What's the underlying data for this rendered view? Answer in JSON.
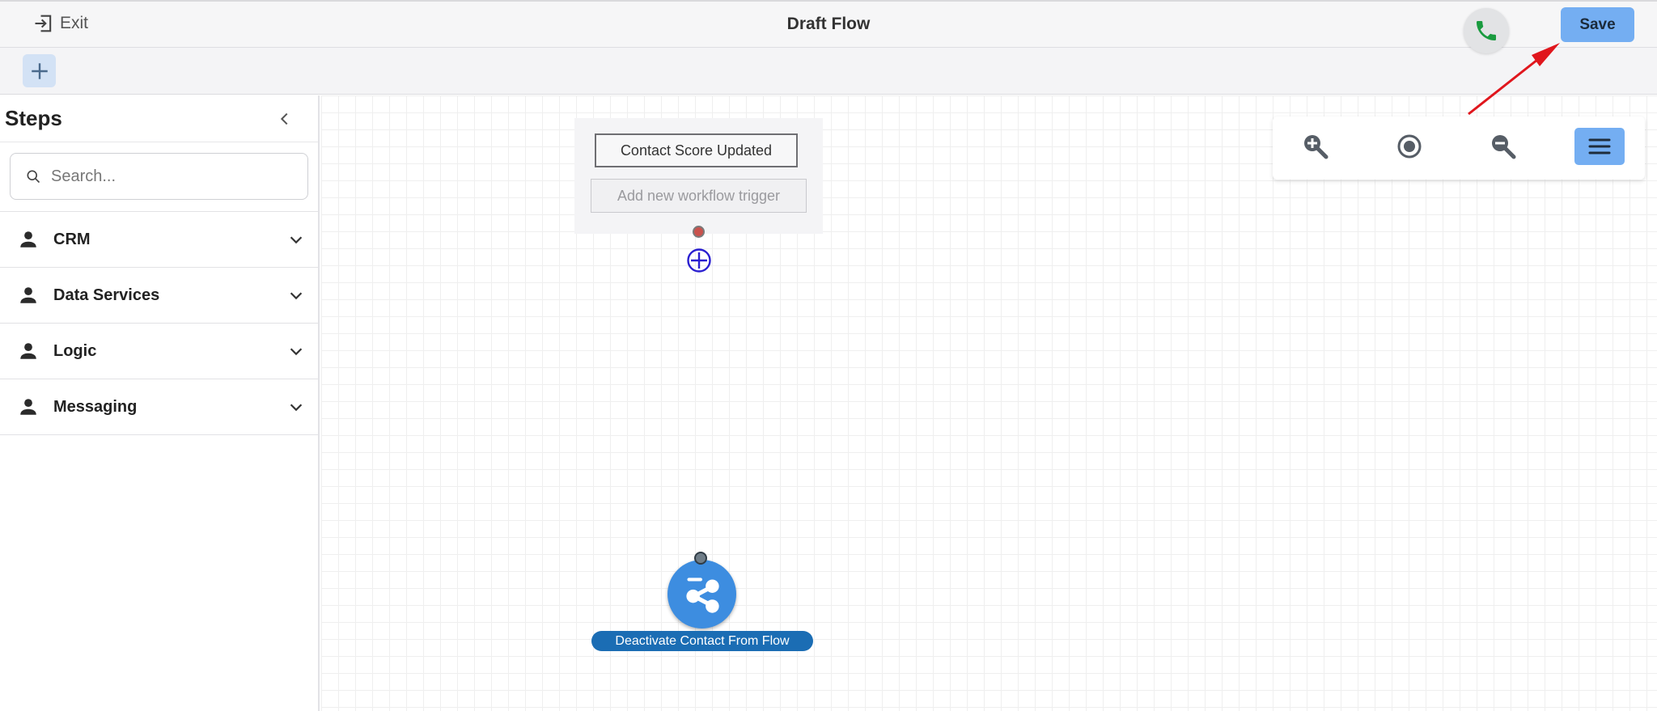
{
  "header": {
    "exit_label": "Exit",
    "title": "Draft Flow",
    "save_label": "Save"
  },
  "sidebar": {
    "title": "Steps",
    "search_placeholder": "Search...",
    "categories": [
      {
        "label": "CRM",
        "icon": "person-icon"
      },
      {
        "label": "Data Services",
        "icon": "person-icon"
      },
      {
        "label": "Logic",
        "icon": "person-icon"
      },
      {
        "label": "Messaging",
        "icon": "person-icon"
      }
    ]
  },
  "canvas": {
    "trigger_label": "Contact Score Updated",
    "add_trigger_label": "Add new workflow trigger",
    "action_node_label": "Deactivate Contact From Flow",
    "action_node_icon": "share-icon"
  },
  "zoom_controls": [
    "zoom-in-icon",
    "center-icon",
    "zoom-out-icon",
    "menu-icon"
  ],
  "colors": {
    "accent": "#74aef2",
    "node_fill": "#3d8de0",
    "node_label_bg": "#1b6db4",
    "phone_green": "#1a9b3f",
    "annotation_arrow": "#e0161d"
  }
}
